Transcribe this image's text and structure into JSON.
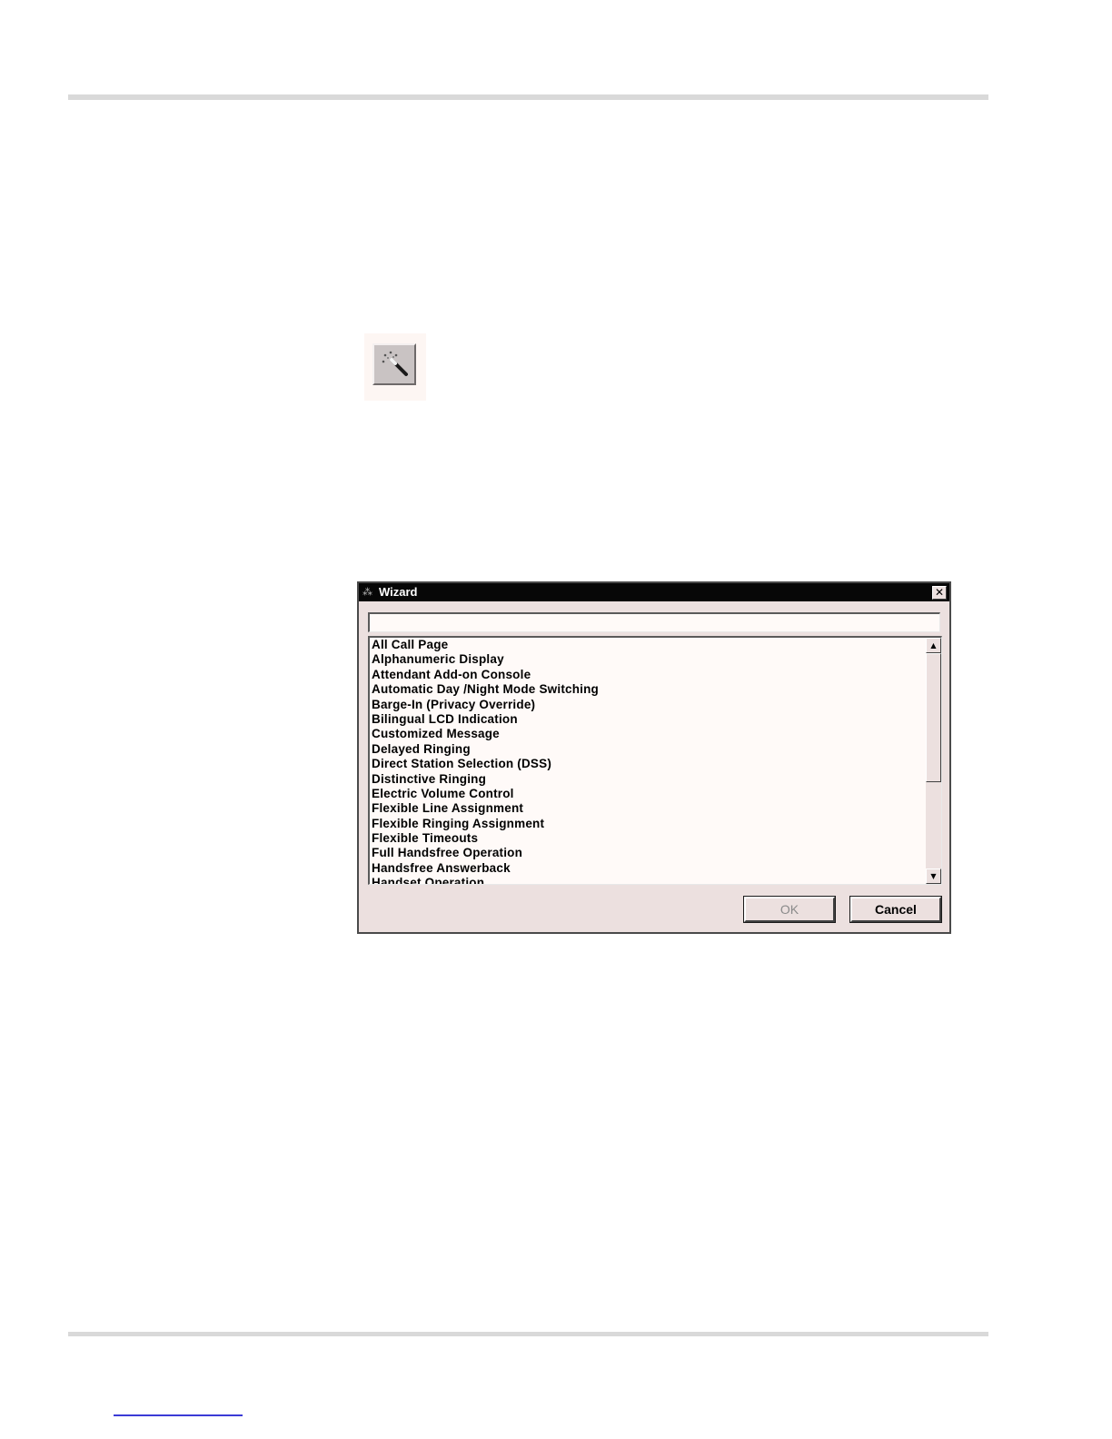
{
  "wizard_dialog": {
    "title": "Wizard",
    "title_icon": "wand-icon",
    "close_glyph": "✕",
    "filter_value": "",
    "list_items": [
      "All Call Page",
      "Alphanumeric Display",
      "Attendant Add-on Console",
      "Automatic Day /Night Mode Switching",
      "Barge-In (Privacy Override)",
      "Bilingual LCD Indication",
      "Customized Message",
      "Delayed Ringing",
      "Direct Station Selection (DSS)",
      "Distinctive Ringing",
      "Electric Volume Control",
      "Flexible Line Assignment",
      "Flexible Ringing Assignment",
      "Flexible Timeouts",
      "Full Handsfree Operation",
      "Handsfree Answerback",
      "Handset Operation"
    ],
    "ok_label": "OK",
    "cancel_label": "Cancel"
  },
  "toolbar_button": {
    "icon": "wizard-wand-icon"
  },
  "colors": {
    "dialog_background": "#ece0df",
    "titlebar": "#070707",
    "list_background": "#fffaf8"
  }
}
